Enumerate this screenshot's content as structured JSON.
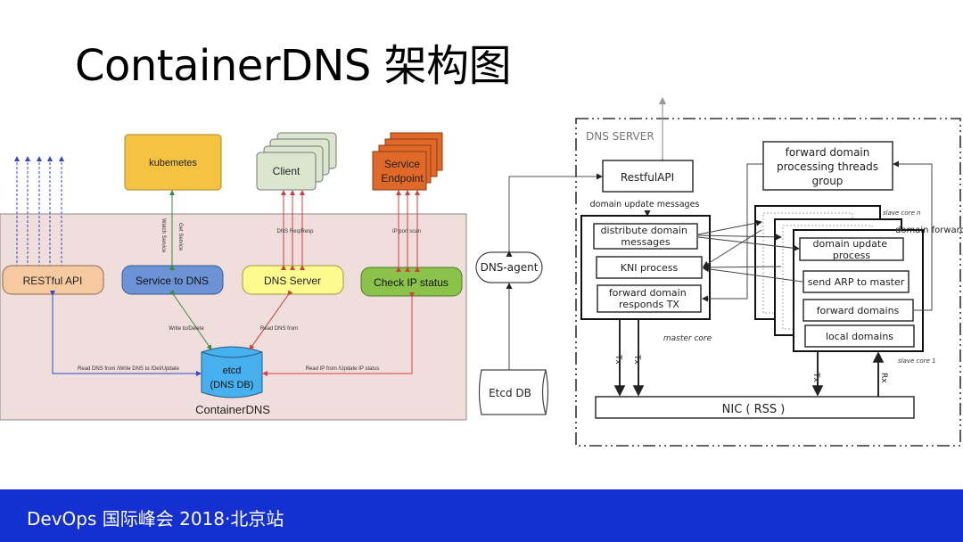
{
  "slide": {
    "title": "ContainerDNS 架构图",
    "footer": "DevOps 国际峰会 2018·北京站"
  },
  "left_diagram": {
    "container_label": "ContainerDNS",
    "external": {
      "kubernetes": "kubemetes",
      "client": "Client",
      "service_endpoint_line1": "Service",
      "service_endpoint_line2": "Endpoint"
    },
    "components": {
      "restful_api": "RESTful API",
      "service_to_dns": "Service to DNS",
      "dns_server": "DNS Server",
      "check_ip_status": "Check IP status",
      "etcd_line1": "etcd",
      "etcd_line2": "(DNS DB)"
    },
    "edge_labels": {
      "get_service": "Get Service",
      "watch_service": "Watch Service",
      "dns_req_resp": "DNS Req/Resp",
      "ip_port_scan": "IP port scan",
      "write_delete": "Write to/Delete",
      "read_dns_from": "Read DNS from",
      "restful_etcd": "Read DNS from /Write DNS to /Del/Update",
      "checkip_etcd": "Read IP from /Update IP status"
    },
    "colors": {
      "container_bg": "#f0dedd",
      "kubernetes": "#f5c242",
      "client": "#dbe6cf",
      "service_endpoint": "#e0692a",
      "restful_api": "#f7c9a0",
      "service_to_dns": "#6b93d6",
      "dns_server": "#fdfb8e",
      "check_ip_status": "#8bc34a",
      "etcd": "#47b0ee"
    }
  },
  "right_diagram": {
    "dns_agent": "DNS-agent",
    "etcd_db": "Etcd DB",
    "dns_server_label": "DNS SERVER",
    "restful_api": "RestfulAPI",
    "domain_update_messages": "domain update  messages",
    "master_core": {
      "label": "master core",
      "items": [
        "distribute domain messages",
        "KNI process",
        "forward domain responds TX"
      ]
    },
    "forward_group_line1": "forward domain",
    "forward_group_line2": "processing threads",
    "forward_group_line3": "group",
    "slave_core_n": "slave core n",
    "slave_core_1": "slave core 1",
    "domain_forward": "domain forward",
    "slave_items": [
      "domain update process",
      "send ARP to master",
      "forward domains",
      "local domains"
    ],
    "nic": "NIC ( RSS )",
    "tx": "Tx",
    "rx": "Rx"
  }
}
